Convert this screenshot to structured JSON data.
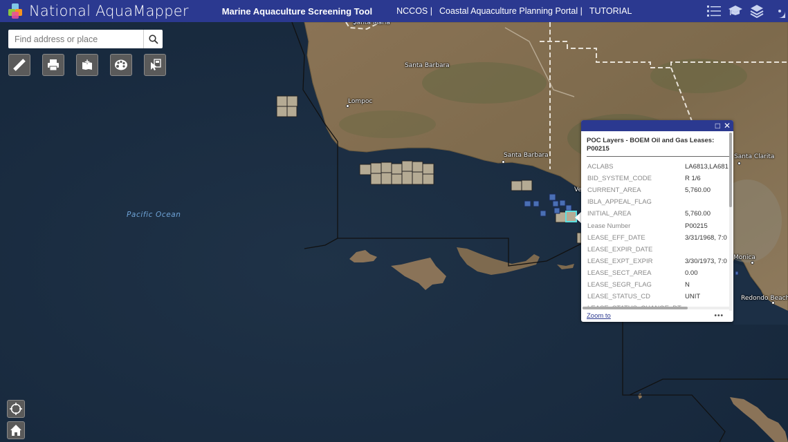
{
  "header": {
    "app_title": "National AquaMapper",
    "tool_title": "Marine Aquaculture Screening Tool",
    "nav_links": [
      "NCCOS |",
      "Coastal Aquaculture Planning Portal |",
      "TUTORIAL"
    ],
    "icons": [
      "list-icon",
      "graduation-cap-icon",
      "layers-icon",
      "noaa-logo-icon"
    ],
    "color": "#2b3990"
  },
  "search": {
    "placeholder": "Find address or place",
    "value": ""
  },
  "toolbar": [
    {
      "name": "measure",
      "icon": "ruler-icon"
    },
    {
      "name": "print",
      "icon": "printer-icon"
    },
    {
      "name": "add-data",
      "icon": "add-data-icon"
    },
    {
      "name": "basemap",
      "icon": "palette-icon"
    },
    {
      "name": "select",
      "icon": "select-cursor-icon"
    }
  ],
  "map_widgets": [
    {
      "name": "locate",
      "icon": "crosshair-icon"
    },
    {
      "name": "home",
      "icon": "home-icon"
    }
  ],
  "map_labels": {
    "ocean": "Pacific Ocean",
    "cities": [
      {
        "name": "Santa Maria"
      },
      {
        "name": "Santa Barbara",
        "kind": "region"
      },
      {
        "name": "Lompoc"
      },
      {
        "name": "Santa Barbara"
      },
      {
        "name": "Ve"
      },
      {
        "name": "Santa Clarita"
      },
      {
        "name": "Monica"
      },
      {
        "name": "Redondo Beach"
      }
    ]
  },
  "popup": {
    "title": "POC Layers - BOEM Oil and Gas Leases: P00215",
    "fields": [
      {
        "key": "ACLABS",
        "value": "LA6813,LA681"
      },
      {
        "key": "BID_SYSTEM_CODE",
        "value": "R 1/6"
      },
      {
        "key": "CURRENT_AREA",
        "value": "5,760.00"
      },
      {
        "key": "IBLA_APPEAL_FLAG",
        "value": ""
      },
      {
        "key": "INITIAL_AREA",
        "value": "5,760.00"
      },
      {
        "key": "Lease Number",
        "value": "P00215"
      },
      {
        "key": "LEASE_EFF_DATE",
        "value": "3/31/1968, 7:0"
      },
      {
        "key": "LEASE_EXPIR_DATE",
        "value": ""
      },
      {
        "key": "LEASE_EXPT_EXPIR",
        "value": "3/30/1973, 7:0"
      },
      {
        "key": "LEASE_SECT_AREA",
        "value": "0.00"
      },
      {
        "key": "LEASE_SEGR_FLAG",
        "value": "N"
      },
      {
        "key": "LEASE_STATUS_CD",
        "value": "UNIT"
      },
      {
        "key": "LEASE_STATUS_CHANGE_DT",
        "value": ""
      }
    ],
    "zoom_to": "Zoom to",
    "more": "•••",
    "maximize_icon": "□",
    "close_icon": "✕"
  }
}
